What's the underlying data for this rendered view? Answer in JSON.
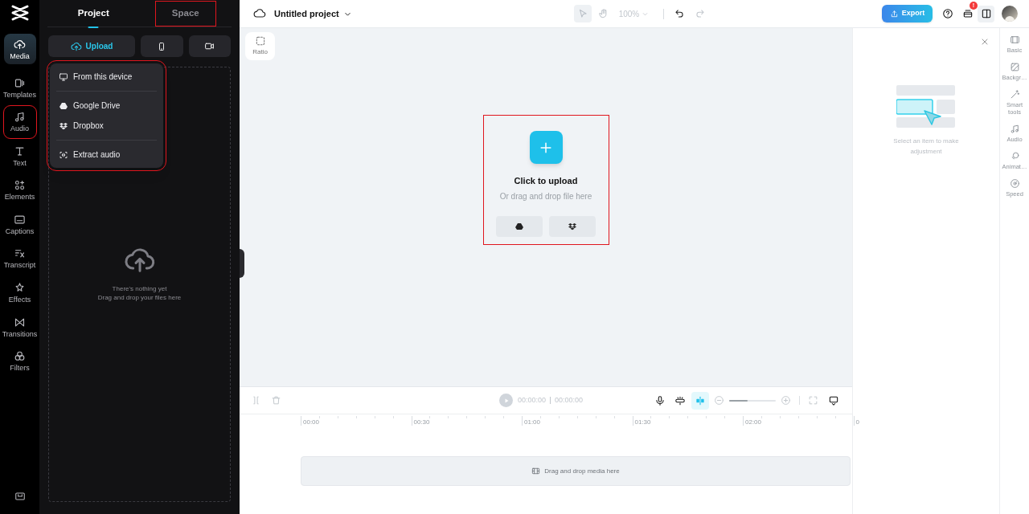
{
  "rail": {
    "items": [
      {
        "label": "Media",
        "selected": true,
        "highlighted": false
      },
      {
        "label": "Templates",
        "selected": false,
        "highlighted": false
      },
      {
        "label": "Audio",
        "selected": false,
        "highlighted": true
      },
      {
        "label": "Text",
        "selected": false,
        "highlighted": false
      },
      {
        "label": "Elements",
        "selected": false,
        "highlighted": false
      },
      {
        "label": "Captions",
        "selected": false,
        "highlighted": false
      },
      {
        "label": "Transcript",
        "selected": false,
        "highlighted": false
      },
      {
        "label": "Effects",
        "selected": false,
        "highlighted": false
      },
      {
        "label": "Transitions",
        "selected": false,
        "highlighted": false
      },
      {
        "label": "Filters",
        "selected": false,
        "highlighted": false
      }
    ]
  },
  "panel": {
    "tabs": [
      {
        "label": "Project",
        "selected": true,
        "highlighted": false
      },
      {
        "label": "Space",
        "selected": false,
        "highlighted": true
      }
    ],
    "upload_button": "Upload",
    "menu": {
      "highlighted": true,
      "groups": [
        [
          {
            "kind": "device",
            "label": "From this device"
          }
        ],
        [
          {
            "kind": "drive",
            "label": "Google Drive"
          },
          {
            "kind": "dropbox",
            "label": "Dropbox"
          }
        ],
        [
          {
            "kind": "extract",
            "label": "Extract audio"
          }
        ]
      ]
    },
    "empty": {
      "title": "There's nothing yet",
      "subtitle": "Drag and drop your files here"
    }
  },
  "topbar": {
    "project_title": "Untitled project",
    "zoom": "100%",
    "export": "Export",
    "notification_badge": "!"
  },
  "canvas": {
    "ratio": "Ratio",
    "upload": {
      "title": "Click to upload",
      "subtitle": "Or drag and drop file here",
      "highlighted": true
    }
  },
  "properties": {
    "hint": "Select an item to make adjustment",
    "tabs": [
      {
        "label": "Basic",
        "disabled": true
      },
      {
        "label": "Backgr…",
        "disabled": true
      },
      {
        "label": "Smart tools",
        "disabled": true
      },
      {
        "label": "Audio",
        "disabled": true
      },
      {
        "label": "Animat…",
        "disabled": true
      },
      {
        "label": "Speed",
        "disabled": true
      }
    ]
  },
  "timeline": {
    "current_time": "00:00:00",
    "duration": "00:00:00",
    "zoom": {
      "level": 0.4
    },
    "ruler": [
      "00:00",
      "00:30",
      "01:00",
      "01:30",
      "02:00",
      "0"
    ],
    "drop_hint": "Drag and drop media here"
  }
}
